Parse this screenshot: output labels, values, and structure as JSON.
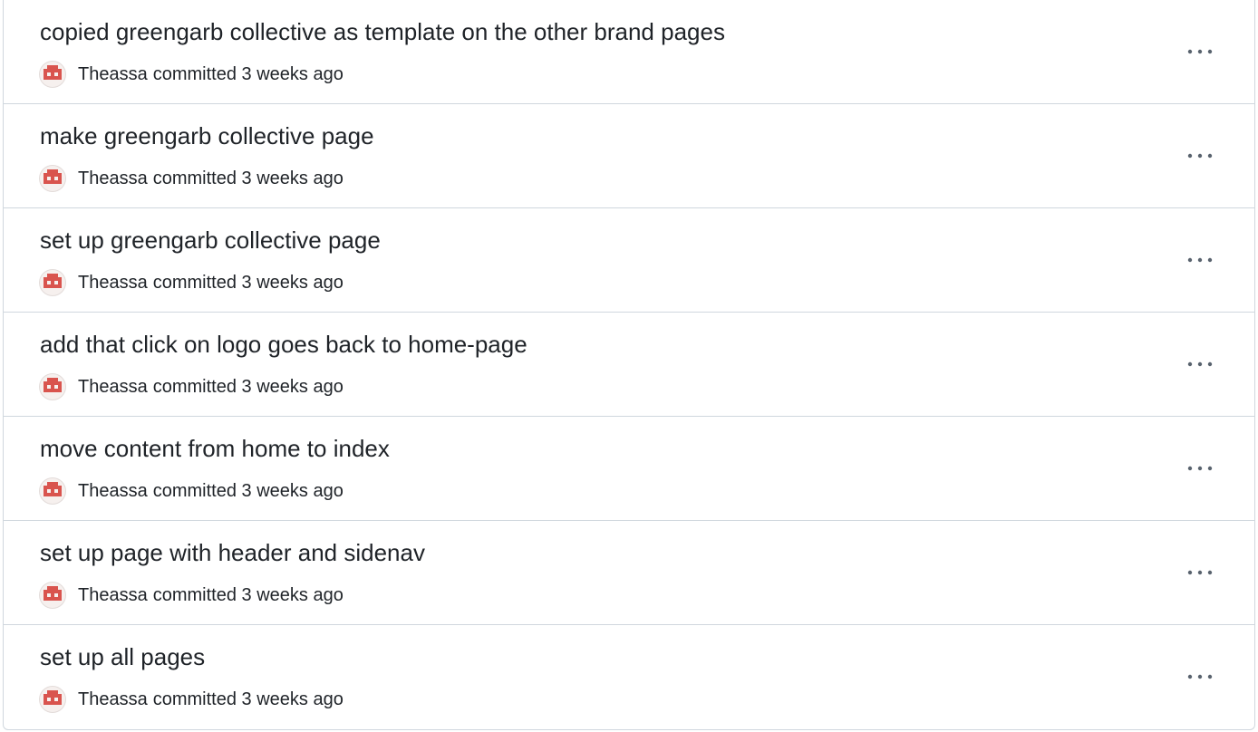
{
  "commits": [
    {
      "title": "copied greengarb collective as template on the other brand pages",
      "author": "Theassa",
      "action": "committed",
      "time": "3 weeks ago"
    },
    {
      "title": "make greengarb collective page",
      "author": "Theassa",
      "action": "committed",
      "time": "3 weeks ago"
    },
    {
      "title": "set up greengarb collective page",
      "author": "Theassa",
      "action": "committed",
      "time": "3 weeks ago"
    },
    {
      "title": "add that click on logo goes back to home-page",
      "author": "Theassa",
      "action": "committed",
      "time": "3 weeks ago"
    },
    {
      "title": "move content from home to index",
      "author": "Theassa",
      "action": "committed",
      "time": "3 weeks ago"
    },
    {
      "title": "set up page with header and sidenav",
      "author": "Theassa",
      "action": "committed",
      "time": "3 weeks ago"
    },
    {
      "title": "set up all pages",
      "author": "Theassa",
      "action": "committed",
      "time": "3 weeks ago"
    }
  ],
  "icons": {
    "avatar": "identicon-avatar",
    "more": "kebab-horizontal-icon"
  },
  "colors": {
    "avatar_accent": "#d9544e",
    "border": "#d0d7de",
    "muted_icon": "#59636e"
  }
}
